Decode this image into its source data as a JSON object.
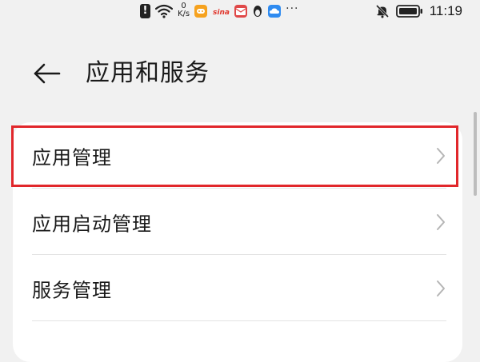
{
  "status_bar": {
    "network_speed_value": "0",
    "network_speed_unit": "K/s",
    "sina_label": "sina",
    "more_indicator": "···",
    "time": "11:19"
  },
  "header": {
    "title": "应用和服务"
  },
  "menu": {
    "items": [
      {
        "label": "应用管理"
      },
      {
        "label": "应用启动管理"
      },
      {
        "label": "服务管理"
      }
    ]
  },
  "colors": {
    "background": "#f1f1f1",
    "card": "#ffffff",
    "highlight": "#e1272b",
    "text": "#1a1a1a",
    "chevron": "#b5b5b5"
  }
}
